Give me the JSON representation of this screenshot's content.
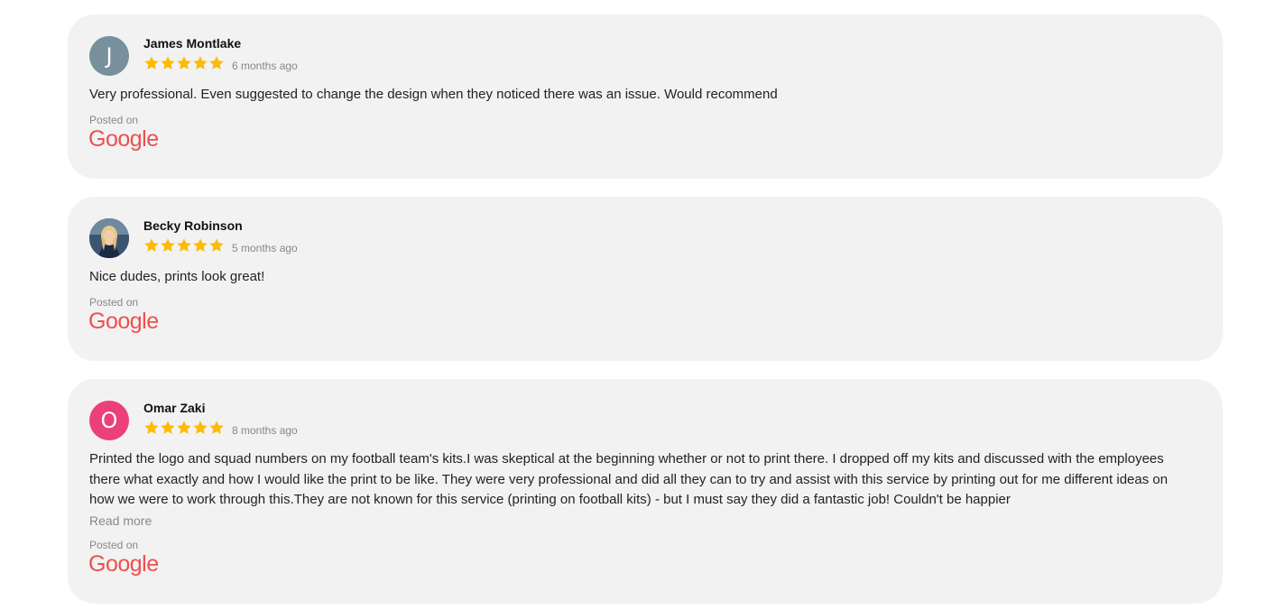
{
  "reviews": [
    {
      "author": "James Montlake",
      "initial": "J",
      "avatar_color": "#78909c",
      "rating": 5,
      "date": "6 months ago",
      "text": "Very professional. Even suggested to change the design when they noticed there was an issue. Would recommend",
      "posted_on_label": "Posted on",
      "source": "Google"
    },
    {
      "author": "Becky Robinson",
      "initial": "",
      "avatar_color": "#2a3f5c",
      "rating": 5,
      "date": "5 months ago",
      "text": "Nice dudes, prints look great!",
      "posted_on_label": "Posted on",
      "source": "Google"
    },
    {
      "author": "Omar Zaki",
      "initial": "O",
      "avatar_color": "#ec407a",
      "rating": 5,
      "date": "8 months ago",
      "text": "Printed the logo and squad numbers on my football team's kits.I was skeptical at the beginning whether or not to print there. I dropped off my kits and discussed with the employees there what exactly and how I would like the print to be like. They were very professional and did all they can to try and assist with this service by printing out for me different ideas on how we were to work through this.They are not known for this service (printing on football kits) - but I must say they did a fantastic job! Couldn't be happier",
      "read_more": "Read more",
      "posted_on_label": "Posted on",
      "source": "Google"
    }
  ],
  "colors": {
    "star": "#fbbc04",
    "google_logo": "#ef4f4f",
    "card_bg": "#f2f2f2"
  }
}
